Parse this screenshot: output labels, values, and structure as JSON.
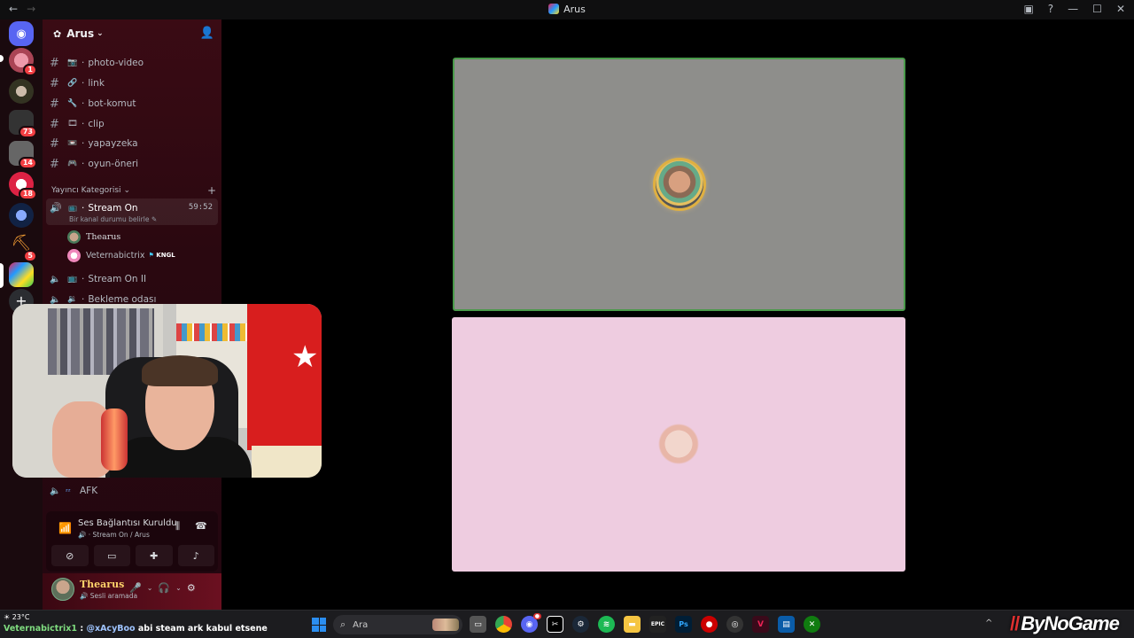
{
  "window": {
    "title": "Arus"
  },
  "server": {
    "name": "Arus"
  },
  "rail": {
    "badges": [
      "1",
      "73",
      "14",
      "18",
      "5"
    ]
  },
  "channels": [
    {
      "name": "photo-video",
      "icon": "📷"
    },
    {
      "name": "link",
      "icon": "🔗"
    },
    {
      "name": "bot-komut",
      "icon": "🔧"
    },
    {
      "name": "clip",
      "icon": "🎞"
    },
    {
      "name": "yapayzeka",
      "icon": "📼"
    },
    {
      "name": "oyun-öneri",
      "icon": "🎮"
    }
  ],
  "category": {
    "name": "Yayıncı Kategorisi"
  },
  "active_voice": {
    "name": "Stream On",
    "timer": "59:52",
    "status": "Bir kanal durumu belirle"
  },
  "voice_users": [
    {
      "name": "Thearus",
      "tag": ""
    },
    {
      "name": "Veternabictrix",
      "tag": "KNGL"
    }
  ],
  "voice_channels": [
    {
      "name": "Stream On II"
    },
    {
      "name": "Bekleme odası"
    },
    {
      "name": "AFK"
    }
  ],
  "voice_panel": {
    "title": "Ses Bağlantısı Kuruldu",
    "subtitle": "Stream On / Arus"
  },
  "user_panel": {
    "name": "Thearus",
    "status": "Sesli aramada"
  },
  "taskbar": {
    "weather": "23°C",
    "chat_user": "Veternabictrix1",
    "chat_mention": "@xAcyBoo",
    "chat_message": "abi steam ark kabul etsene",
    "search_placeholder": "Ara",
    "brand": "ByNoGame"
  }
}
